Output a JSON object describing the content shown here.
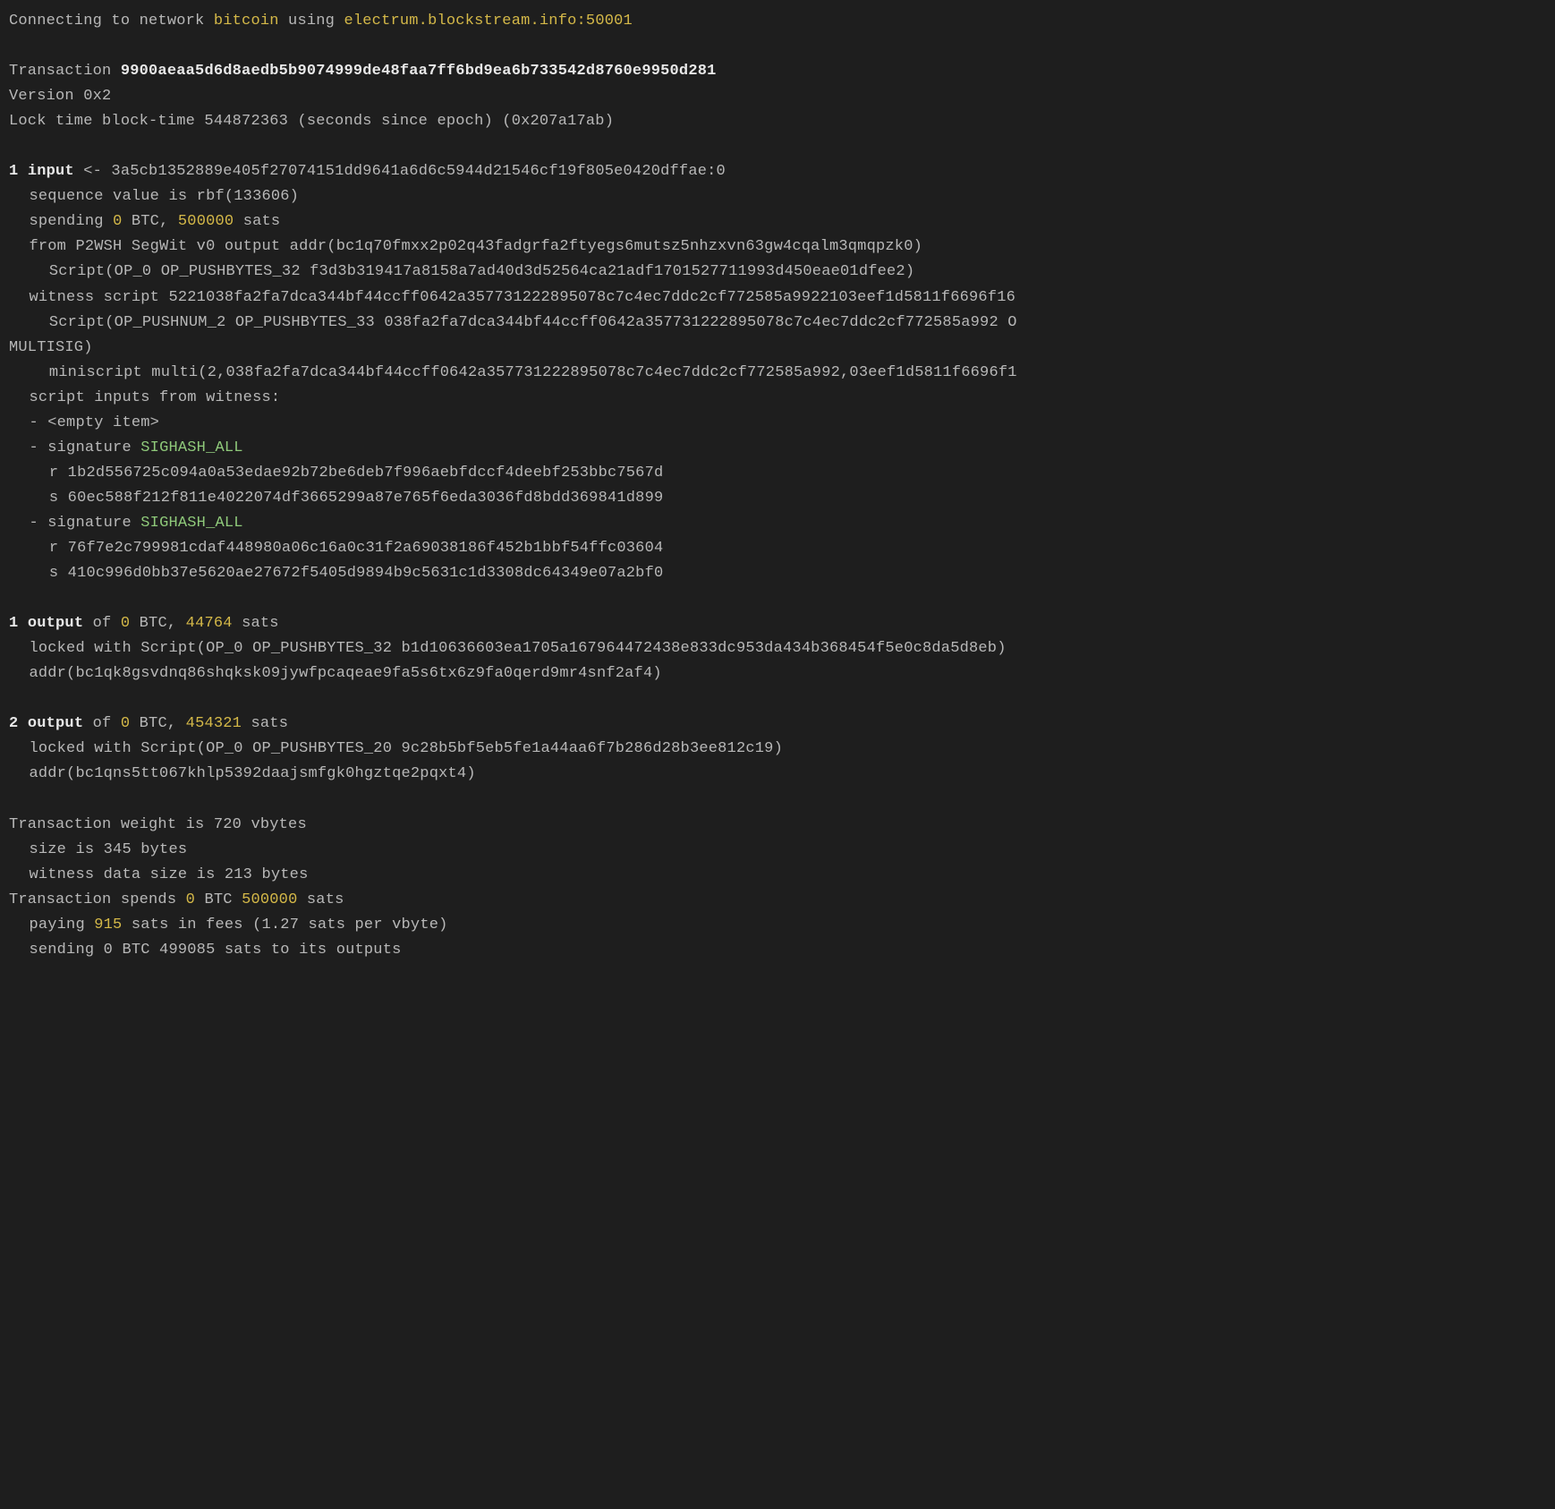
{
  "connect": {
    "prefix": "Connecting to network ",
    "network": "bitcoin",
    "using": " using ",
    "endpoint": "electrum.blockstream.info:50001"
  },
  "tx": {
    "label": "Transaction ",
    "hash": "9900aeaa5d6d8aedb5b9074999de48faa7ff6bd9ea6b733542d8760e9950d281",
    "version": "Version 0x2",
    "locktime": "Lock time block-time 544872363 (seconds since epoch) (0x207a17ab)"
  },
  "input": {
    "num_label": "1 ",
    "head_bold": "input",
    "head_rest": " <- 3a5cb1352889e405f27074151dd9641a6d6c5944d21546cf19f805e0420dffae:0",
    "sequence": "sequence value is rbf(133606)",
    "spending_pre": "spending ",
    "spending_amt_btc": "0",
    "spending_mid": " BTC, ",
    "spending_sats": "500000",
    "spending_post": " sats",
    "from": "from P2WSH SegWit v0 output addr(bc1q70fmxx2p02q43fadgrfa2ftyegs6mutsz5nhzxvn63gw4cqalm3qmqpzk0)",
    "from_script": "Script(OP_0 OP_PUSHBYTES_32 f3d3b319417a8158a7ad40d3d52564ca21adf1701527711993d450eae01dfee2)",
    "witness_script": "witness script 5221038fa2fa7dca344bf44ccff0642a357731222895078c7c4ec7ddc2cf772585a9922103eef1d5811f6696f16",
    "witness_script_decoded": "Script(OP_PUSHNUM_2 OP_PUSHBYTES_33 038fa2fa7dca344bf44ccff0642a357731222895078c7c4ec7ddc2cf772585a992 O",
    "multisig_tail": "MULTISIG)",
    "miniscript": "miniscript multi(2,038fa2fa7dca344bf44ccff0642a357731222895078c7c4ec7ddc2cf772585a992,03eef1d5811f6696f1",
    "script_inputs_label": "script inputs from witness:",
    "empty_item": "- <empty item>",
    "sig_label": "- signature ",
    "sighash": "SIGHASH_ALL",
    "sig1_r": "r 1b2d556725c094a0a53edae92b72be6deb7f996aebfdccf4deebf253bbc7567d",
    "sig1_s": "s 60ec588f212f811e4022074df3665299a87e765f6eda3036fd8bdd369841d899",
    "sig2_r": "r 76f7e2c799981cdaf448980a06c16a0c31f2a69038186f452b1bbf54ffc03604",
    "sig2_s": "s 410c996d0bb37e5620ae27672f5405d9894b9c5631c1d3308dc64349e07a2bf0"
  },
  "out1": {
    "num_label": "1 ",
    "head_bold": "output",
    "mid1": " of ",
    "btc": "0",
    "mid2": " BTC, ",
    "sats": "44764",
    "post": " sats",
    "locked": "locked with Script(OP_0 OP_PUSHBYTES_32 b1d10636603ea1705a167964472438e833dc953da434b368454f5e0c8da5d8eb)",
    "addr": "addr(bc1qk8gsvdnq86shqksk09jywfpcaqeae9fa5s6tx6z9fa0qerd9mr4snf2af4)"
  },
  "out2": {
    "num_label": "2 ",
    "head_bold": "output",
    "mid1": " of ",
    "btc": "0",
    "mid2": " BTC, ",
    "sats": "454321",
    "post": " sats",
    "locked": "locked with Script(OP_0 OP_PUSHBYTES_20 9c28b5bf5eb5fe1a44aa6f7b286d28b3ee812c19)",
    "addr": "addr(bc1qns5tt067khlp5392daajsmfgk0hgztqe2pqxt4)"
  },
  "summary": {
    "weight": "Transaction weight is 720 vbytes",
    "size": "size is 345 bytes",
    "wsize": "witness data size is 213 bytes",
    "spends_pre": "Transaction spends ",
    "spends_btc": "0",
    "spends_mid": " BTC ",
    "spends_sats": "500000",
    "spends_post": " sats",
    "paying_pre": "paying ",
    "paying_sats": "915",
    "paying_post": " sats in fees (1.27 sats per vbyte)",
    "sending": "sending 0 BTC 499085 sats to its outputs"
  }
}
